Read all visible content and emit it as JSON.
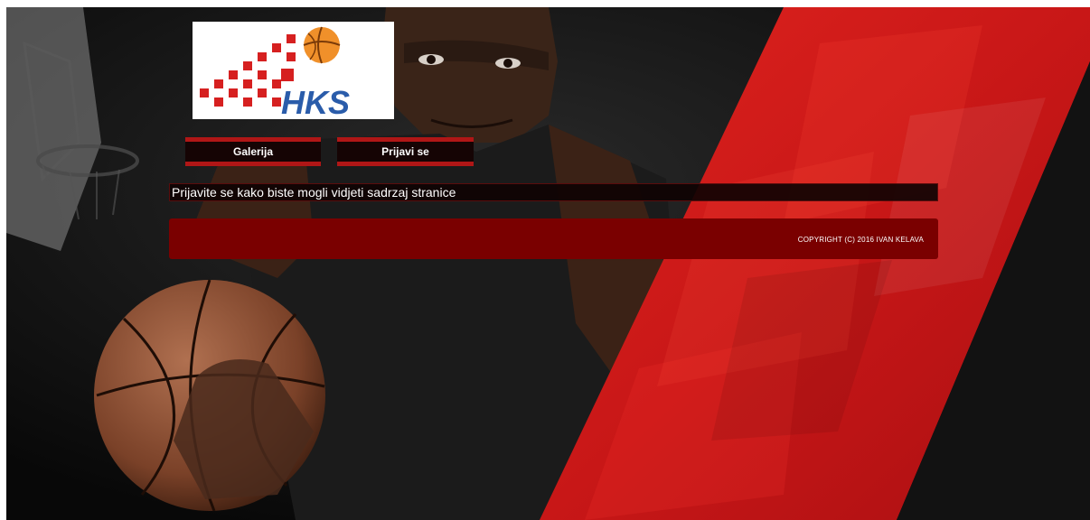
{
  "logo": {
    "text": "HKS"
  },
  "nav": {
    "items": [
      {
        "label": "Galerija"
      },
      {
        "label": "Prijavi se"
      }
    ]
  },
  "notice": {
    "text": "Prijavite se kako biste mogli vidjeti sadrzaj stranice"
  },
  "footer": {
    "copyright": "COPYRIGHT (C) 2016 IVAN KELAVA"
  },
  "colors": {
    "accent_red": "#b01616",
    "footer_red": "#7a0000",
    "background": "#0d0d0d",
    "logo_blue": "#2a5caa"
  }
}
